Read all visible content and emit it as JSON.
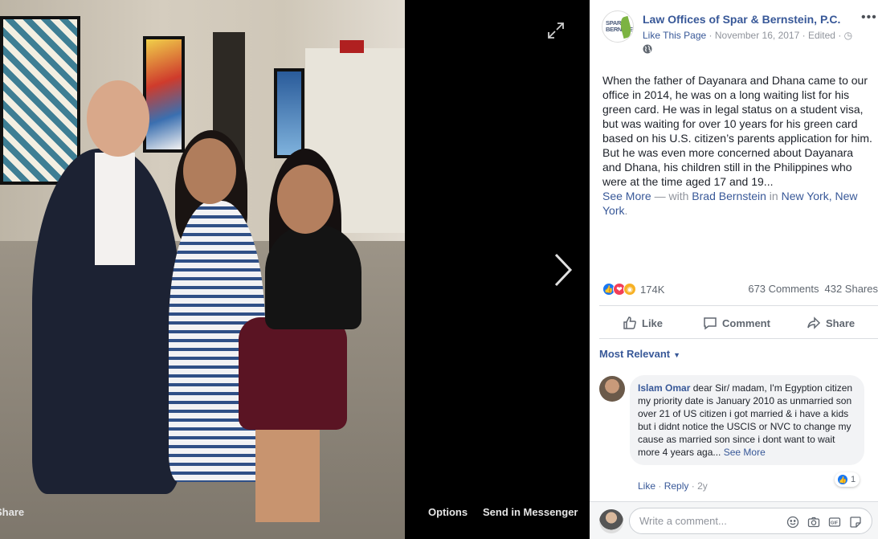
{
  "viewer": {
    "share_label": "Share",
    "options_label": "Options",
    "messenger_label": "Send in Messenger"
  },
  "post": {
    "page_name": "Law Offices of Spar & Bernstein, P.C.",
    "logo_text": "SPAR BERNSTEIN",
    "like_page": "Like This Page",
    "date": "November 16, 2017",
    "edited": "Edited",
    "text": "When the father of Dayanara and Dhana came to our office in 2014, he was on a long waiting list for his green card. He was in legal status on a student visa, but was waiting for over 10 years for his green card based on his U.S. citizen’s parents application for him. But he was even more concerned about Dayanara and Dhana, his children still in the Philippines who were at the time aged 17 and 19...",
    "see_more": "See More",
    "with_label": "— with",
    "tagged_person": "Brad Bernstein",
    "in_label": "in",
    "location": "New York, New York",
    "location_period": "."
  },
  "stats": {
    "reactions": "174K",
    "comments": "673 Comments",
    "shares": "432 Shares"
  },
  "actions": {
    "like": "Like",
    "comment": "Comment",
    "share": "Share"
  },
  "comments_section": {
    "sort_label": "Most Relevant",
    "comment": {
      "author": "Islam Omar",
      "text": "dear Sir/ madam, I'm Egyption citizen my priority date is January 2010 as unmarried son over 21 of US citizen i got married & i have a kids but i didnt notice the USCIS or NVC to change my cause as married son since i dont want to wait more 4 years aga...",
      "see_more": "See More",
      "like_count": "1",
      "like_action": "Like",
      "reply_action": "Reply",
      "age": "2y"
    },
    "write_placeholder": "Write a comment..."
  },
  "colors": {
    "link_blue": "#385898",
    "like_blue": "#1877f2",
    "love_red": "#f33e58",
    "wow_yellow": "#f7b125"
  }
}
